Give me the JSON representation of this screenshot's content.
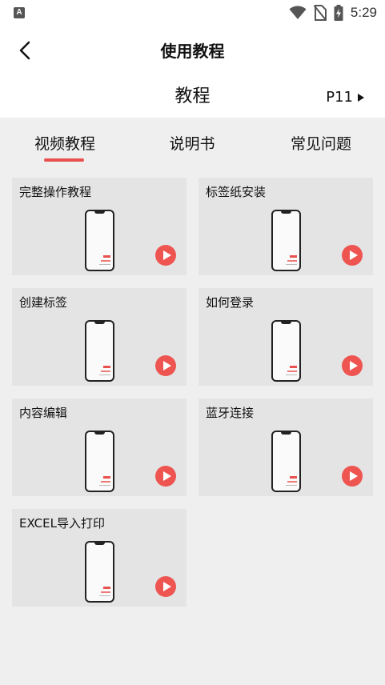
{
  "status_bar": {
    "time": "5:29",
    "app_icon_letter": "A",
    "icons": [
      "wifi-icon",
      "no-sim-icon",
      "battery-charging-icon"
    ]
  },
  "header": {
    "title": "使用教程",
    "back_icon": "chevron-left-icon"
  },
  "subheader": {
    "title": "教程",
    "model": "P11",
    "model_icon": "caret-right-icon"
  },
  "tabs": [
    {
      "label": "视频教程",
      "active": true
    },
    {
      "label": "说明书",
      "active": false
    },
    {
      "label": "常见问题",
      "active": false
    }
  ],
  "videos": [
    {
      "title": "完整操作教程"
    },
    {
      "title": "标签纸安装"
    },
    {
      "title": "创建标签"
    },
    {
      "title": "如何登录"
    },
    {
      "title": "内容编辑"
    },
    {
      "title": "蓝牙连接"
    },
    {
      "title": "EXCEL导入打印"
    }
  ],
  "colors": {
    "accent": "#e8514d",
    "page_bg": "#efefef",
    "card_bg": "#e4e4e4"
  }
}
